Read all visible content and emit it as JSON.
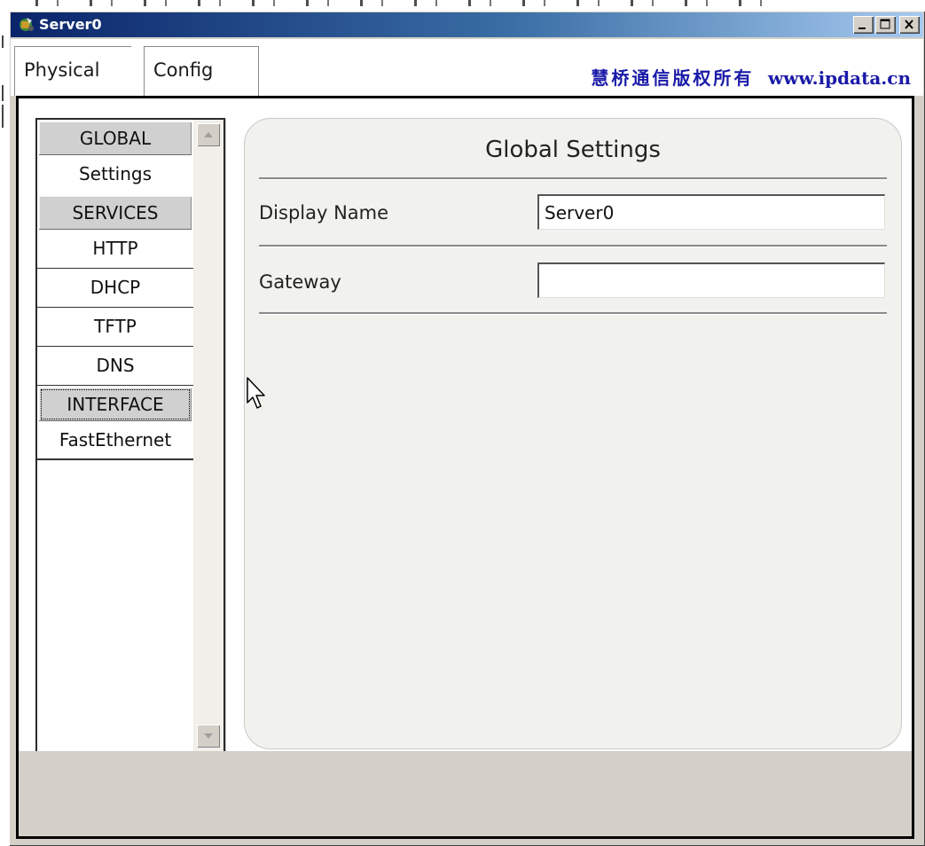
{
  "window": {
    "title": "Server0",
    "icon": "server-icon",
    "controls": {
      "minimize": "minimize-icon",
      "maximize": "maximize-icon",
      "close": "close-icon"
    }
  },
  "tabs": [
    {
      "label": "Physical",
      "selected": false
    },
    {
      "label": "Config",
      "selected": true
    }
  ],
  "banner": {
    "cn_text": "慧桥通信版权所有",
    "url_text": "www.ipdata.cn",
    "color": "#1a1aa8"
  },
  "sidebar": {
    "items": [
      {
        "label": "GLOBAL",
        "type": "header"
      },
      {
        "label": "Settings",
        "type": "item"
      },
      {
        "label": "SERVICES",
        "type": "header"
      },
      {
        "label": "HTTP",
        "type": "item"
      },
      {
        "label": "DHCP",
        "type": "item"
      },
      {
        "label": "TFTP",
        "type": "item"
      },
      {
        "label": "DNS",
        "type": "item"
      },
      {
        "label": "INTERFACE",
        "type": "header"
      },
      {
        "label": "FastEthernet",
        "type": "item"
      }
    ]
  },
  "panel": {
    "title": "Global Settings",
    "fields": [
      {
        "label": "Display Name",
        "value": "Server0"
      },
      {
        "label": "Gateway",
        "value": ""
      }
    ]
  },
  "colors": {
    "titlebar_start": "#0a246a",
    "titlebar_end": "#a6caf0",
    "window_face": "#d4d0c8",
    "panel_bg": "#f1f1ee"
  }
}
